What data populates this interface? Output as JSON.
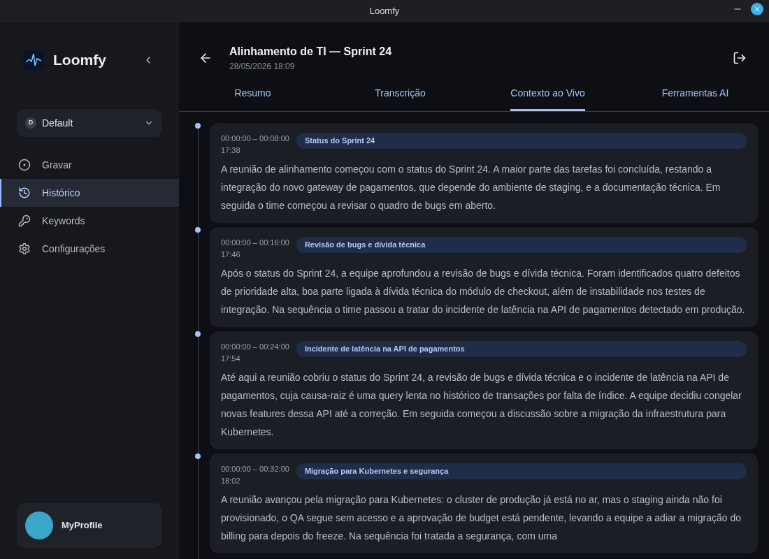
{
  "window": {
    "title": "Loomfy"
  },
  "sidebar": {
    "brand": "Loomfy",
    "workspace": {
      "initial": "D",
      "name": "Default"
    },
    "items": [
      {
        "label": "Gravar",
        "kind": "record",
        "selected": false
      },
      {
        "label": "Histórico",
        "kind": "history",
        "selected": true
      },
      {
        "label": "Keywords",
        "kind": "key",
        "selected": false
      },
      {
        "label": "Configurações",
        "kind": "gear",
        "selected": false
      }
    ],
    "profile": {
      "name": "MyProfile"
    }
  },
  "header": {
    "title": "Alinhamento de TI — Sprint 24",
    "date": "28/05/2026 18:09"
  },
  "tabs": [
    {
      "label": "Resumo",
      "selected": false
    },
    {
      "label": "Transcrição",
      "selected": false
    },
    {
      "label": "Contexto ao Vivo",
      "selected": true
    },
    {
      "label": "Ferramentas AI",
      "selected": false
    }
  ],
  "entries": [
    {
      "range": "00:00:00 – 00:08:00",
      "time": "17:38",
      "topic": "Status do Sprint 24",
      "text": "A reunião de alinhamento começou com o status do Sprint 24. A maior parte das tarefas foi concluída, restando a integração do novo gateway de pagamentos, que depende do ambiente de staging, e a documentação técnica. Em seguida o time começou a revisar o quadro de bugs em aberto."
    },
    {
      "range": "00:00:00 – 00:16:00",
      "time": "17:46",
      "topic": "Revisão de bugs e dívida técnica",
      "text": "Após o status do Sprint 24, a equipe aprofundou a revisão de bugs e dívida técnica. Foram identificados quatro defeitos de prioridade alta, boa parte ligada à dívida técnica do módulo de checkout, além de instabilidade nos testes de integração. Na sequência o time passou a tratar do incidente de latência na API de pagamentos detectado em produção."
    },
    {
      "range": "00:00:00 – 00:24:00",
      "time": "17:54",
      "topic": "Incidente de latência na API de pagamentos",
      "text": "Até aqui a reunião cobriu o status do Sprint 24, a revisão de bugs e dívida técnica e o incidente de latência na API de pagamentos, cuja causa-raiz é uma query lenta no histórico de transações por falta de índice. A equipe decidiu congelar novas features dessa API até a correção. Em seguida começou a discussão sobre a migração da infraestrutura para Kubernetes."
    },
    {
      "range": "00:00:00 – 00:32:00",
      "time": "18:02",
      "topic": "Migração para Kubernetes e segurança",
      "text": "A reunião avançou pela migração para Kubernetes: o cluster de produção já está no ar, mas o staging ainda não foi provisionado, o QA segue sem acesso e a aprovação de budget está pendente, levando a equipe a adiar a migração do billing para depois do freeze. Na sequência foi tratada a segurança, com uma"
    }
  ]
}
